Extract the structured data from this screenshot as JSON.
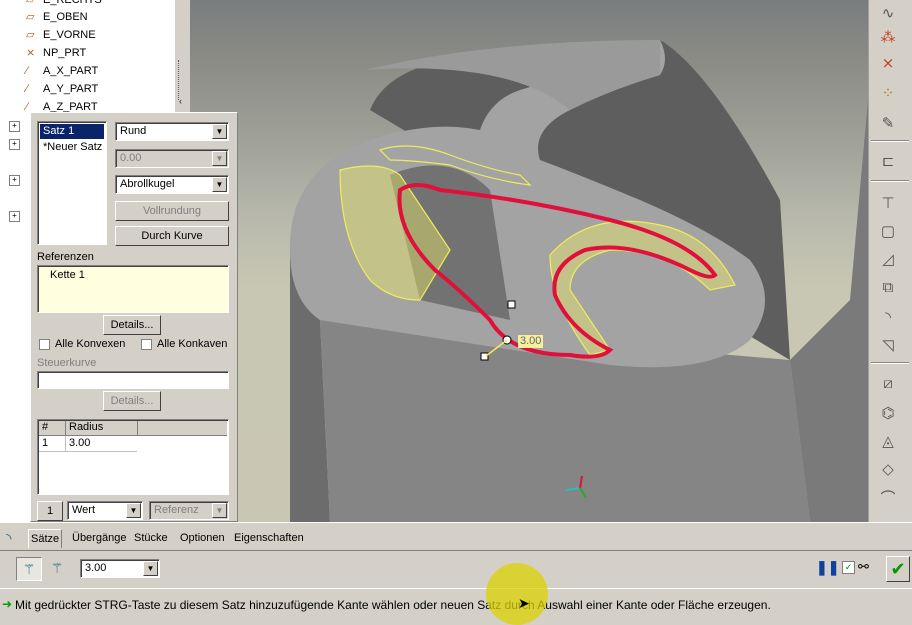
{
  "model_tree": {
    "items": [
      {
        "label": "E_RECHTS",
        "icon": "datum-plane-icon"
      },
      {
        "label": "E_OBEN",
        "icon": "datum-plane-icon"
      },
      {
        "label": "E_VORNE",
        "icon": "datum-plane-icon"
      },
      {
        "label": "NP_PRT",
        "icon": "coordinate-system-icon"
      },
      {
        "label": "A_X_PART",
        "icon": "datum-axis-icon"
      },
      {
        "label": "A_Y_PART",
        "icon": "datum-axis-icon"
      },
      {
        "label": "A_Z_PART",
        "icon": "datum-axis-icon"
      }
    ],
    "expand_glyph": "+"
  },
  "sets": {
    "items": [
      "Satz 1",
      "*Neuer Satz"
    ],
    "selected": "Satz 1"
  },
  "controls": {
    "shape_type": "Rund",
    "value_disabled": "0.00",
    "method": "Abrollkugel",
    "full_round_button": "Vollrundung",
    "through_curve_button": "Durch Kurve"
  },
  "references": {
    "label": "Referenzen",
    "items": [
      "Kette 1"
    ],
    "details_button": "Details..."
  },
  "checkboxes": {
    "all_convex": "Alle Konvexen",
    "all_concave": "Alle Konkaven"
  },
  "guide_curve": {
    "label": "Steuerkurve",
    "value": "",
    "details_button": "Details..."
  },
  "radius_table": {
    "headers": [
      "#",
      "Radius"
    ],
    "rows": [
      [
        "1",
        "3.00"
      ]
    ]
  },
  "row_controls": {
    "index": "1",
    "mode": "Wert",
    "reference": "Referenz"
  },
  "viewport": {
    "dimension_label": "3.00",
    "colors": {
      "highlight_edge": "#e0103a",
      "preview": "#f0ec5a",
      "model": "#8a8a8a"
    }
  },
  "tabs": [
    "Sätze",
    "Übergänge",
    "Stücke",
    "Optionen",
    "Eigenschaften"
  ],
  "active_tab": "Sätze",
  "dashboard": {
    "radius_value": "3.00"
  },
  "status": {
    "message": "Mit gedrückter STRG-Taste zu diesem Satz hinzuzufügende Kante wählen oder neuen Satz durch Auswahl einer Kante oder Fläche erzeugen."
  }
}
